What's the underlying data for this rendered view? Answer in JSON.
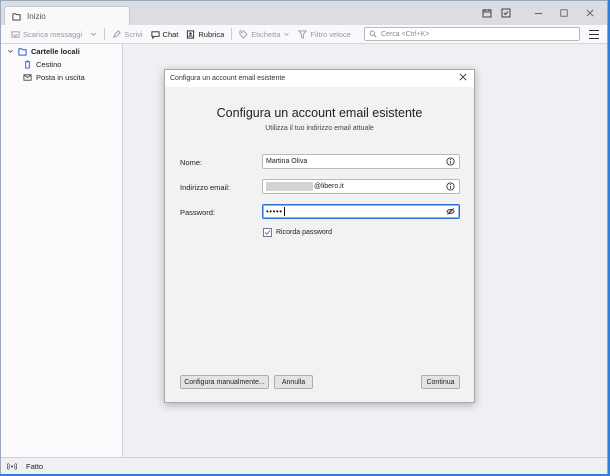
{
  "tab": {
    "label": "Inizio"
  },
  "toolbar": {
    "get_messages": "Scarica messaggi",
    "write": "Scrivi",
    "chat": "Chat",
    "address_book": "Rubrica",
    "tag": "Etichetta",
    "quick_filter": "Filtro veloce",
    "search_placeholder": "Cerca <Ctrl+K>"
  },
  "sidebar": {
    "items": [
      {
        "label": "Cartelle locali",
        "icon": "folder-icon"
      },
      {
        "label": "Cestino",
        "icon": "trash-icon"
      },
      {
        "label": "Posta in uscita",
        "icon": "outbox-icon"
      }
    ]
  },
  "status": {
    "text": "Fatto"
  },
  "dialog": {
    "window_title": "Configura un account email esistente",
    "heading": "Configura un account email esistente",
    "subheading": "Utilizza il tuo indirizzo email attuale",
    "fields": {
      "name_label": "Nome:",
      "name_value": "Martina Oliva",
      "email_label": "Indirizzo email:",
      "email_value": "@libero.it",
      "password_label": "Password:",
      "password_value": "•••••"
    },
    "remember_password": "Ricorda password",
    "buttons": {
      "manual": "Configura manualmente...",
      "cancel": "Annulla",
      "continue": "Continua"
    }
  },
  "colors": {
    "focus": "#2f6fd6",
    "desktop": "#2f7fd8"
  }
}
